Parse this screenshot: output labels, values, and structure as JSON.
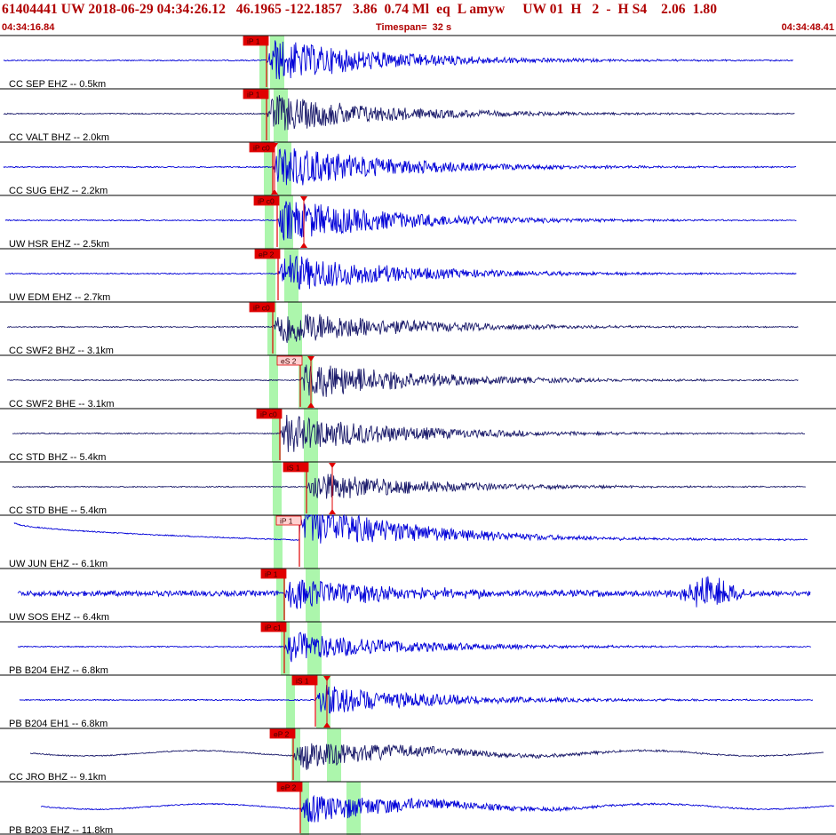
{
  "header": {
    "summary": "61404441 UW 2018-06-29 04:34:26.12   46.1965 -122.1857   3.86  0.74 Ml  eq  L amyw     UW 01  H   2  -  H S4    2.06  1.80",
    "start_time": "04:34:16.84",
    "timespan": "Timespan=  32 s",
    "end_time": "04:34:48.41"
  },
  "colors": {
    "trace_blue": "#0000d8",
    "trace_navy": "#1a1a6a",
    "pick_red": "#e00000",
    "pick_window_green": "#9ef59e",
    "header_red": "#b00000"
  },
  "channels": [
    {
      "label": "CC SEP EHZ -- 0.5km",
      "pick": "iP 1",
      "pick_style": "solid",
      "s_pick": "",
      "style": "blue"
    },
    {
      "label": "CC VALT BHZ -- 2.0km",
      "pick": "iP 1",
      "pick_style": "solid",
      "s_pick": "",
      "style": "navy"
    },
    {
      "label": "CC SUG EHZ -- 2.2km",
      "pick": "iP c0",
      "pick_style": "solid",
      "s_pick": "",
      "style": "blue"
    },
    {
      "label": "UW HSR EHZ -- 2.5km",
      "pick": "iP c0",
      "pick_style": "solid",
      "s_pick": "",
      "style": "blue"
    },
    {
      "label": "UW EDM EHZ -- 2.7km",
      "pick": "eP 2",
      "pick_style": "solid",
      "s_pick": "",
      "style": "blue"
    },
    {
      "label": "CC SWF2 BHZ -- 3.1km",
      "pick": "iP c0",
      "pick_style": "solid",
      "s_pick": "",
      "style": "navy"
    },
    {
      "label": "CC SWF2 BHE -- 3.1km",
      "pick": "eS 2",
      "pick_style": "outline",
      "s_pick": "",
      "style": "navy"
    },
    {
      "label": "CC STD BHZ -- 5.4km",
      "pick": "iP c0",
      "pick_style": "solid",
      "s_pick": "",
      "style": "navy"
    },
    {
      "label": "CC STD BHE -- 5.4km",
      "pick": "iS 1",
      "pick_style": "solid",
      "s_pick": "",
      "style": "navy"
    },
    {
      "label": "UW JUN EHZ -- 6.1km",
      "pick": "iP 1",
      "pick_style": "outline",
      "s_pick": "",
      "style": "blue"
    },
    {
      "label": "UW SOS EHZ -- 6.4km",
      "pick": "iP 1",
      "pick_style": "solid",
      "s_pick": "",
      "style": "blue"
    },
    {
      "label": "PB B204 EHZ -- 6.8km",
      "pick": "iP c1",
      "pick_style": "solid",
      "s_pick": "",
      "style": "blue"
    },
    {
      "label": "PB B204 EH1 -- 6.8km",
      "pick": "iS 1",
      "pick_style": "solid",
      "s_pick": "",
      "style": "blue"
    },
    {
      "label": "CC JRO BHZ -- 9.1km",
      "pick": "eP 2",
      "pick_style": "solid",
      "s_pick": "",
      "style": "navy"
    },
    {
      "label": "PB B203 EHZ -- 11.8km",
      "pick": "eP 2",
      "pick_style": "solid",
      "s_pick": "",
      "style": "blue"
    }
  ]
}
